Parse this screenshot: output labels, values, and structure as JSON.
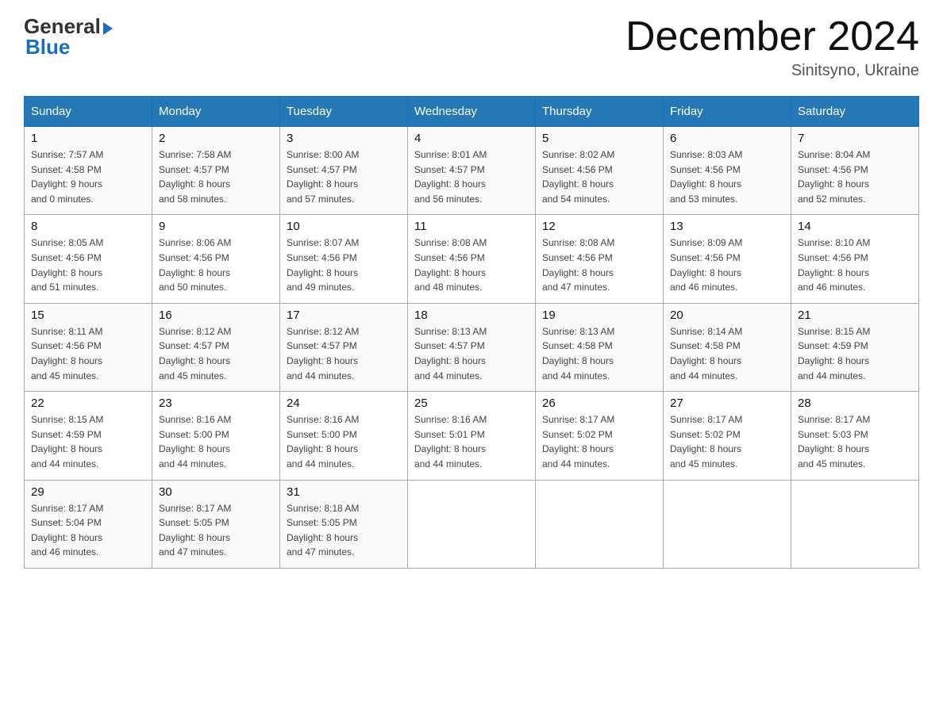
{
  "header": {
    "month_title": "December 2024",
    "location": "Sinitsyno, Ukraine",
    "logo_general": "General",
    "logo_blue": "Blue"
  },
  "days_of_week": [
    "Sunday",
    "Monday",
    "Tuesday",
    "Wednesday",
    "Thursday",
    "Friday",
    "Saturday"
  ],
  "weeks": [
    [
      {
        "day": "1",
        "info": "Sunrise: 7:57 AM\nSunset: 4:58 PM\nDaylight: 9 hours\nand 0 minutes."
      },
      {
        "day": "2",
        "info": "Sunrise: 7:58 AM\nSunset: 4:57 PM\nDaylight: 8 hours\nand 58 minutes."
      },
      {
        "day": "3",
        "info": "Sunrise: 8:00 AM\nSunset: 4:57 PM\nDaylight: 8 hours\nand 57 minutes."
      },
      {
        "day": "4",
        "info": "Sunrise: 8:01 AM\nSunset: 4:57 PM\nDaylight: 8 hours\nand 56 minutes."
      },
      {
        "day": "5",
        "info": "Sunrise: 8:02 AM\nSunset: 4:56 PM\nDaylight: 8 hours\nand 54 minutes."
      },
      {
        "day": "6",
        "info": "Sunrise: 8:03 AM\nSunset: 4:56 PM\nDaylight: 8 hours\nand 53 minutes."
      },
      {
        "day": "7",
        "info": "Sunrise: 8:04 AM\nSunset: 4:56 PM\nDaylight: 8 hours\nand 52 minutes."
      }
    ],
    [
      {
        "day": "8",
        "info": "Sunrise: 8:05 AM\nSunset: 4:56 PM\nDaylight: 8 hours\nand 51 minutes."
      },
      {
        "day": "9",
        "info": "Sunrise: 8:06 AM\nSunset: 4:56 PM\nDaylight: 8 hours\nand 50 minutes."
      },
      {
        "day": "10",
        "info": "Sunrise: 8:07 AM\nSunset: 4:56 PM\nDaylight: 8 hours\nand 49 minutes."
      },
      {
        "day": "11",
        "info": "Sunrise: 8:08 AM\nSunset: 4:56 PM\nDaylight: 8 hours\nand 48 minutes."
      },
      {
        "day": "12",
        "info": "Sunrise: 8:08 AM\nSunset: 4:56 PM\nDaylight: 8 hours\nand 47 minutes."
      },
      {
        "day": "13",
        "info": "Sunrise: 8:09 AM\nSunset: 4:56 PM\nDaylight: 8 hours\nand 46 minutes."
      },
      {
        "day": "14",
        "info": "Sunrise: 8:10 AM\nSunset: 4:56 PM\nDaylight: 8 hours\nand 46 minutes."
      }
    ],
    [
      {
        "day": "15",
        "info": "Sunrise: 8:11 AM\nSunset: 4:56 PM\nDaylight: 8 hours\nand 45 minutes."
      },
      {
        "day": "16",
        "info": "Sunrise: 8:12 AM\nSunset: 4:57 PM\nDaylight: 8 hours\nand 45 minutes."
      },
      {
        "day": "17",
        "info": "Sunrise: 8:12 AM\nSunset: 4:57 PM\nDaylight: 8 hours\nand 44 minutes."
      },
      {
        "day": "18",
        "info": "Sunrise: 8:13 AM\nSunset: 4:57 PM\nDaylight: 8 hours\nand 44 minutes."
      },
      {
        "day": "19",
        "info": "Sunrise: 8:13 AM\nSunset: 4:58 PM\nDaylight: 8 hours\nand 44 minutes."
      },
      {
        "day": "20",
        "info": "Sunrise: 8:14 AM\nSunset: 4:58 PM\nDaylight: 8 hours\nand 44 minutes."
      },
      {
        "day": "21",
        "info": "Sunrise: 8:15 AM\nSunset: 4:59 PM\nDaylight: 8 hours\nand 44 minutes."
      }
    ],
    [
      {
        "day": "22",
        "info": "Sunrise: 8:15 AM\nSunset: 4:59 PM\nDaylight: 8 hours\nand 44 minutes."
      },
      {
        "day": "23",
        "info": "Sunrise: 8:16 AM\nSunset: 5:00 PM\nDaylight: 8 hours\nand 44 minutes."
      },
      {
        "day": "24",
        "info": "Sunrise: 8:16 AM\nSunset: 5:00 PM\nDaylight: 8 hours\nand 44 minutes."
      },
      {
        "day": "25",
        "info": "Sunrise: 8:16 AM\nSunset: 5:01 PM\nDaylight: 8 hours\nand 44 minutes."
      },
      {
        "day": "26",
        "info": "Sunrise: 8:17 AM\nSunset: 5:02 PM\nDaylight: 8 hours\nand 44 minutes."
      },
      {
        "day": "27",
        "info": "Sunrise: 8:17 AM\nSunset: 5:02 PM\nDaylight: 8 hours\nand 45 minutes."
      },
      {
        "day": "28",
        "info": "Sunrise: 8:17 AM\nSunset: 5:03 PM\nDaylight: 8 hours\nand 45 minutes."
      }
    ],
    [
      {
        "day": "29",
        "info": "Sunrise: 8:17 AM\nSunset: 5:04 PM\nDaylight: 8 hours\nand 46 minutes."
      },
      {
        "day": "30",
        "info": "Sunrise: 8:17 AM\nSunset: 5:05 PM\nDaylight: 8 hours\nand 47 minutes."
      },
      {
        "day": "31",
        "info": "Sunrise: 8:18 AM\nSunset: 5:05 PM\nDaylight: 8 hours\nand 47 minutes."
      },
      {
        "day": "",
        "info": ""
      },
      {
        "day": "",
        "info": ""
      },
      {
        "day": "",
        "info": ""
      },
      {
        "day": "",
        "info": ""
      }
    ]
  ]
}
